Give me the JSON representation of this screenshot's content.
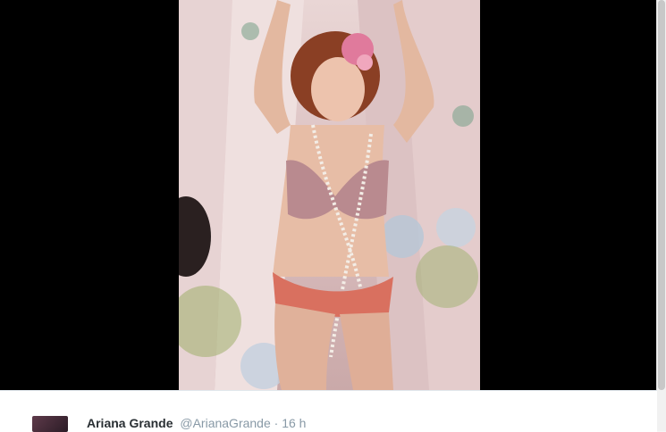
{
  "photo": {
    "description_icon": "photo"
  },
  "tweet": {
    "fullname": "Ariana Grande",
    "handle": "@ArianaGrande",
    "separator": "·",
    "time": "16 h"
  },
  "colors": {
    "viewer_bg": "#000000",
    "card_bg": "#ffffff",
    "name": "#292f33",
    "meta": "#8899a6"
  }
}
